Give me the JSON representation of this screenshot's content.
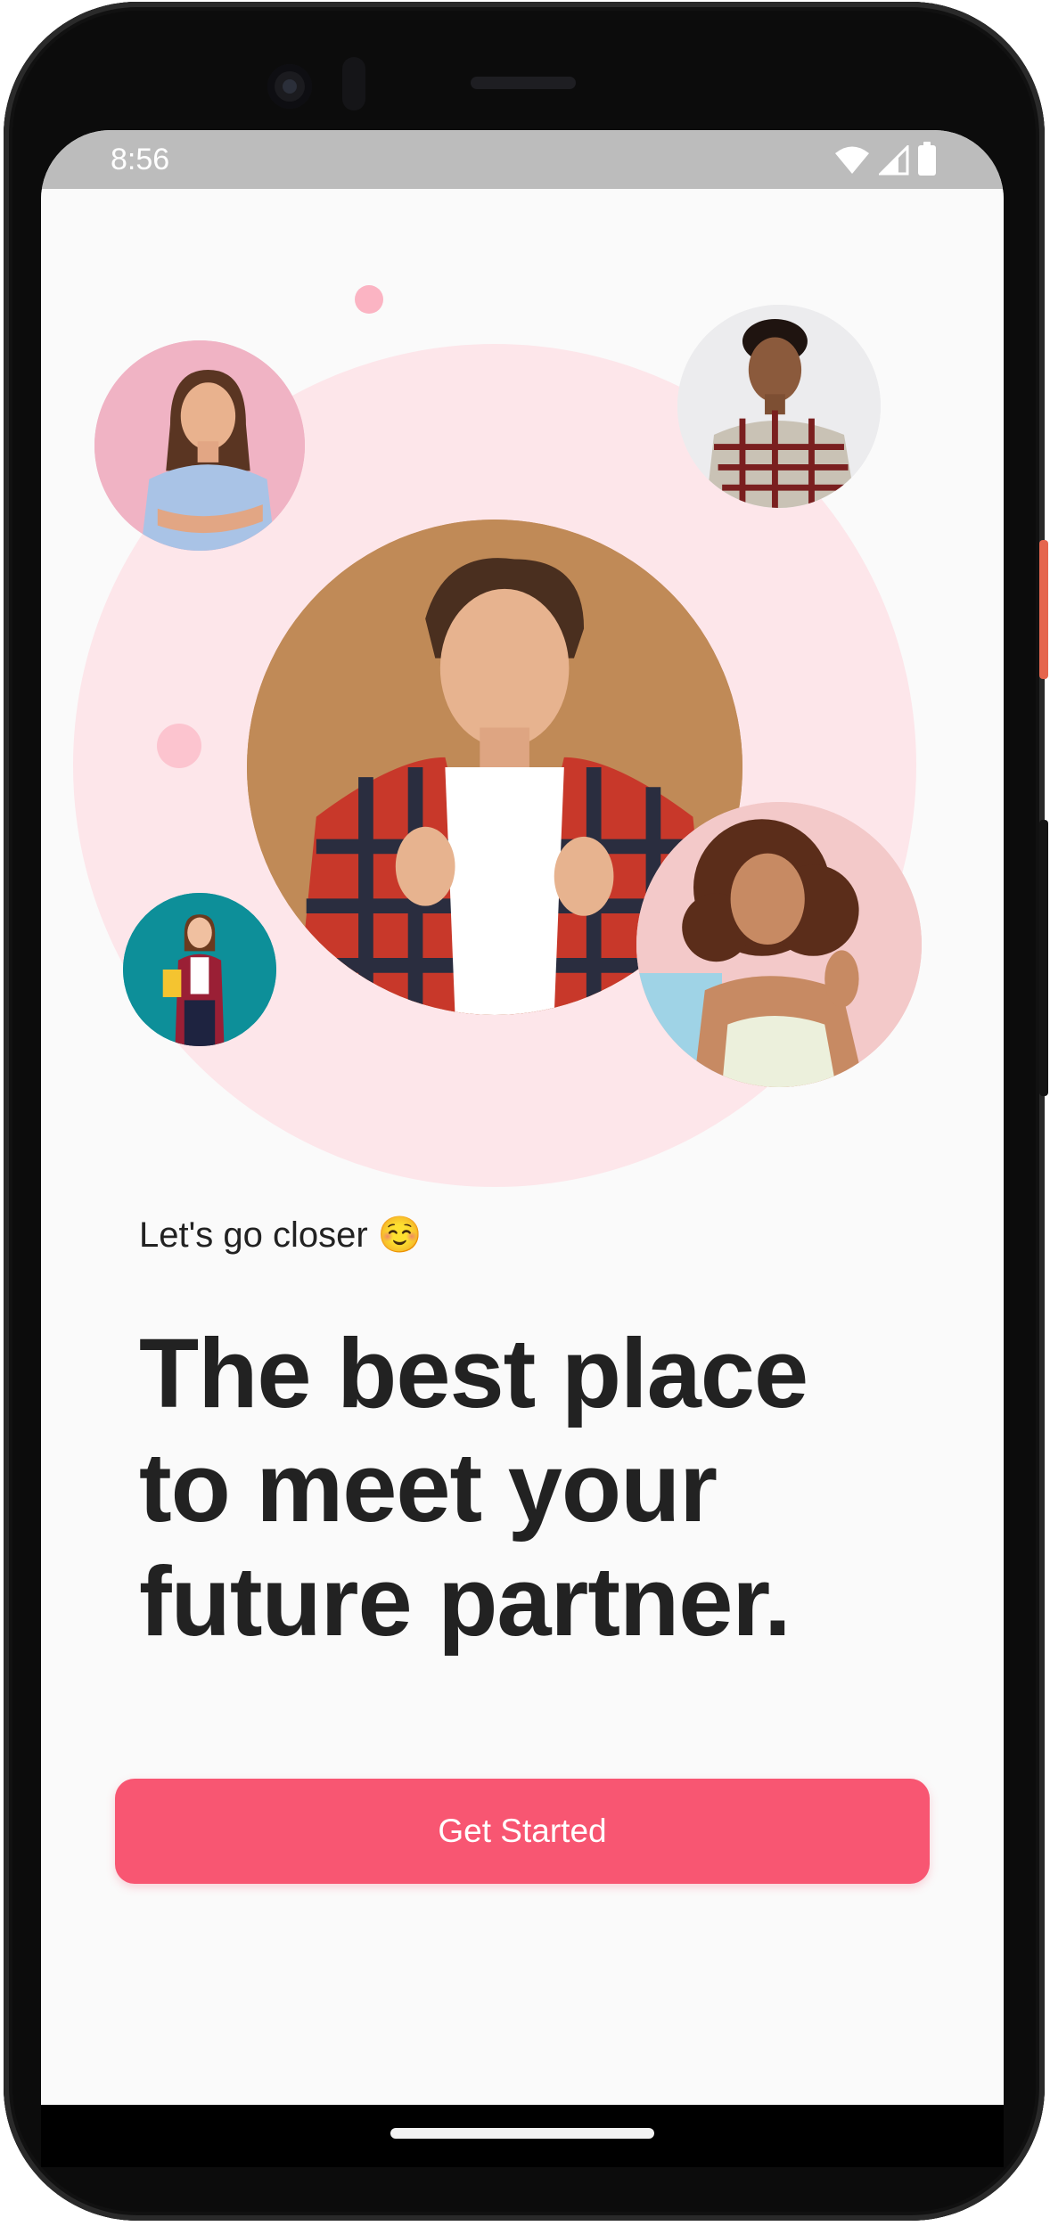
{
  "status_bar": {
    "time": "8:56",
    "icons": [
      "wifi-icon",
      "cellular-signal-icon",
      "battery-icon"
    ]
  },
  "onboarding": {
    "subtitle": "Let's go closer ☺️",
    "headline": "The best place to meet your future partner.",
    "cta_label": "Get Started",
    "avatars": [
      "avatar-man-plaid-shirt",
      "avatar-woman-blue-top",
      "avatar-man-checked-shirt",
      "avatar-woman-curly-hair",
      "avatar-woman-red-cardigan"
    ]
  },
  "colors": {
    "accent": "#f85672",
    "accent_light": "#fde6ea",
    "text": "#222222",
    "background": "#fafafa",
    "status_bar": "#bcbcbc"
  }
}
